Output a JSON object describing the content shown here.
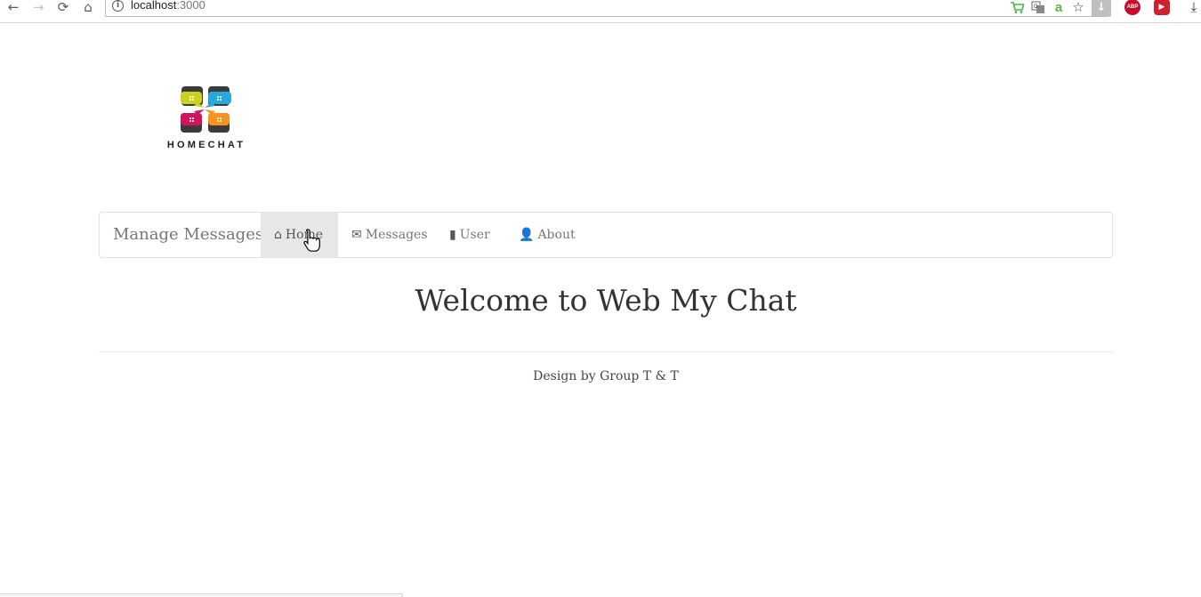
{
  "browser": {
    "url_host": "localhost",
    "url_port": ":3000",
    "back_icon": "←",
    "forward_icon": "→",
    "reload_icon": "⟳",
    "home_icon": "⌂",
    "bookmark_icon": "☆",
    "download_icon": "⤓",
    "abp_label": "ABP"
  },
  "logo": {
    "wordmark": "HOMECHAT",
    "colors": [
      "#c9d21f",
      "#29a8e0",
      "#d4145a",
      "#f7941d",
      "#3b3b3b"
    ]
  },
  "navbar": {
    "brand": "Manage Messages",
    "items": [
      {
        "label": "Home",
        "icon": "⌂",
        "active": true
      },
      {
        "label": "Messages",
        "icon": "✉",
        "active": false
      },
      {
        "label": "User",
        "icon": "▮",
        "active": false
      },
      {
        "label": "About",
        "icon": "👤",
        "active": false
      }
    ]
  },
  "main": {
    "title": "Welcome to Web My Chat",
    "footer": "Design by Group T & T"
  }
}
